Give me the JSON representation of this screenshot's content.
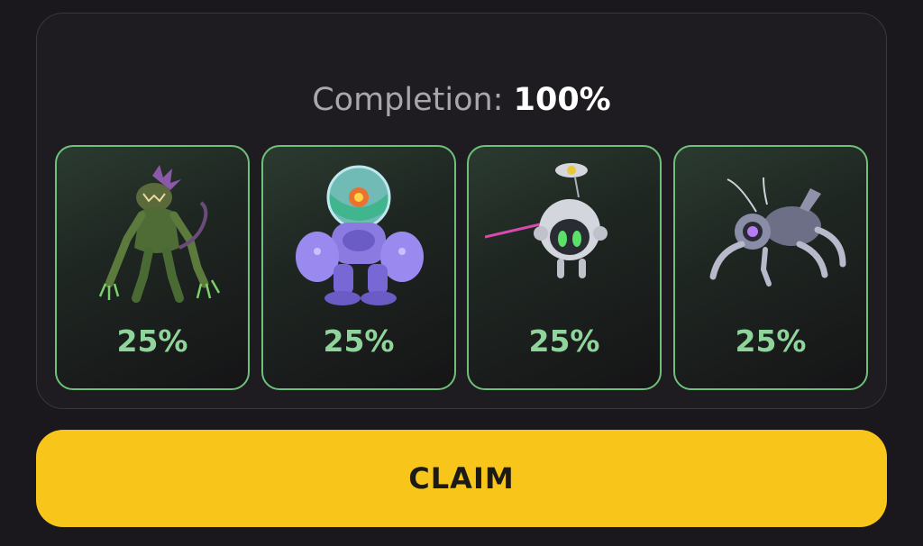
{
  "completion": {
    "label": "Completion:",
    "value": "100%"
  },
  "cards": [
    {
      "icon": "alien-mutant-icon",
      "percent": "25%"
    },
    {
      "icon": "astronaut-robot-icon",
      "percent": "25%"
    },
    {
      "icon": "orb-drone-icon",
      "percent": "25%"
    },
    {
      "icon": "spider-bot-icon",
      "percent": "25%"
    }
  ],
  "claim_button": {
    "label": "CLAIM"
  },
  "colors": {
    "background": "#1b181d",
    "card_border": "#6fc07a",
    "percent_text": "#8fd49a",
    "claim_button": "#f8c61b"
  }
}
